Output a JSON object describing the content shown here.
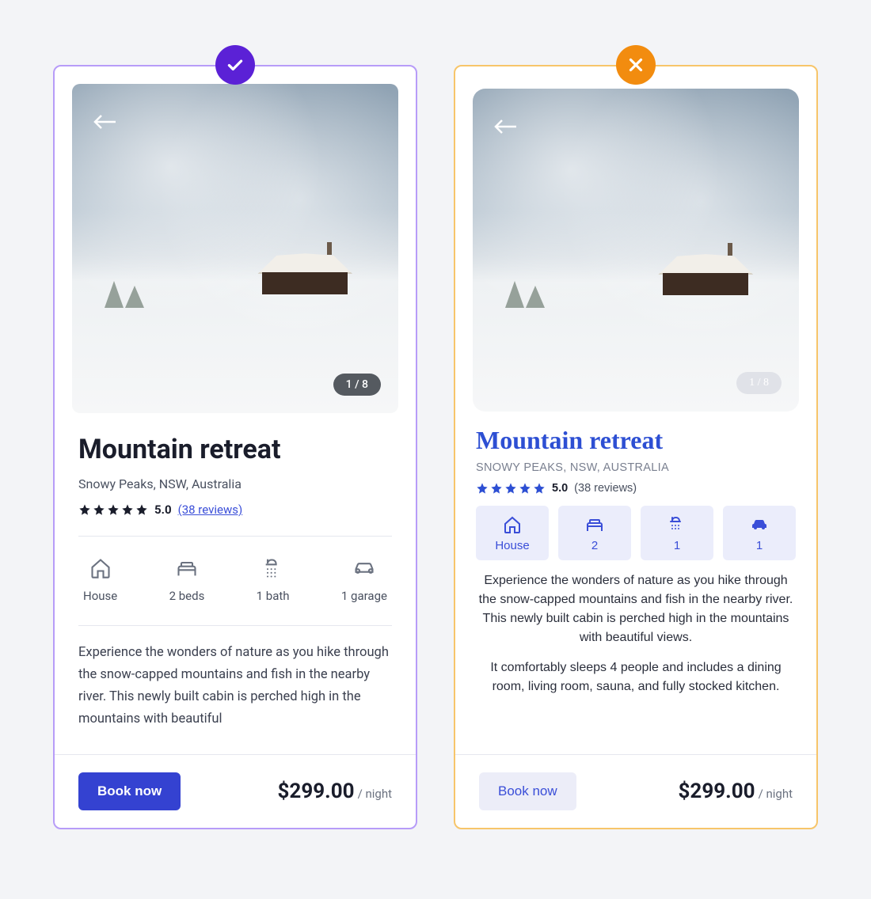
{
  "good": {
    "pager": "1 / 8",
    "title": "Mountain retreat",
    "location": "Snowy Peaks, NSW, Australia",
    "rating": "5.0",
    "reviews": "(38 reviews)",
    "features": {
      "house": "House",
      "beds": "2 beds",
      "bath": "1 bath",
      "garage": "1 garage"
    },
    "description": "Experience the wonders of nature as you hike through the snow-capped mountains and fish in the nearby river. This newly built cabin is perched high in the mountains with beautiful",
    "cta": "Book now",
    "price": "$299.00",
    "price_unit": "/ night"
  },
  "bad": {
    "pager": "1 / 8",
    "title": "Mountain retreat",
    "location": "SNOWY PEAKS, NSW, AUSTRALIA",
    "rating": "5.0",
    "reviews": "(38 reviews)",
    "chips": {
      "house": "House",
      "beds": "2",
      "bath": "1",
      "garage": "1"
    },
    "desc1": "Experience the wonders of nature as you hike through the snow-capped mountains and fish in the nearby river. This newly built cabin is perched high in the mountains with beautiful views.",
    "desc2": "It comfortably sleeps 4 people and includes a dining room, living room, sauna, and fully stocked kitchen.",
    "cta": "Book now",
    "price": "$299.00",
    "price_unit": "/ night"
  }
}
